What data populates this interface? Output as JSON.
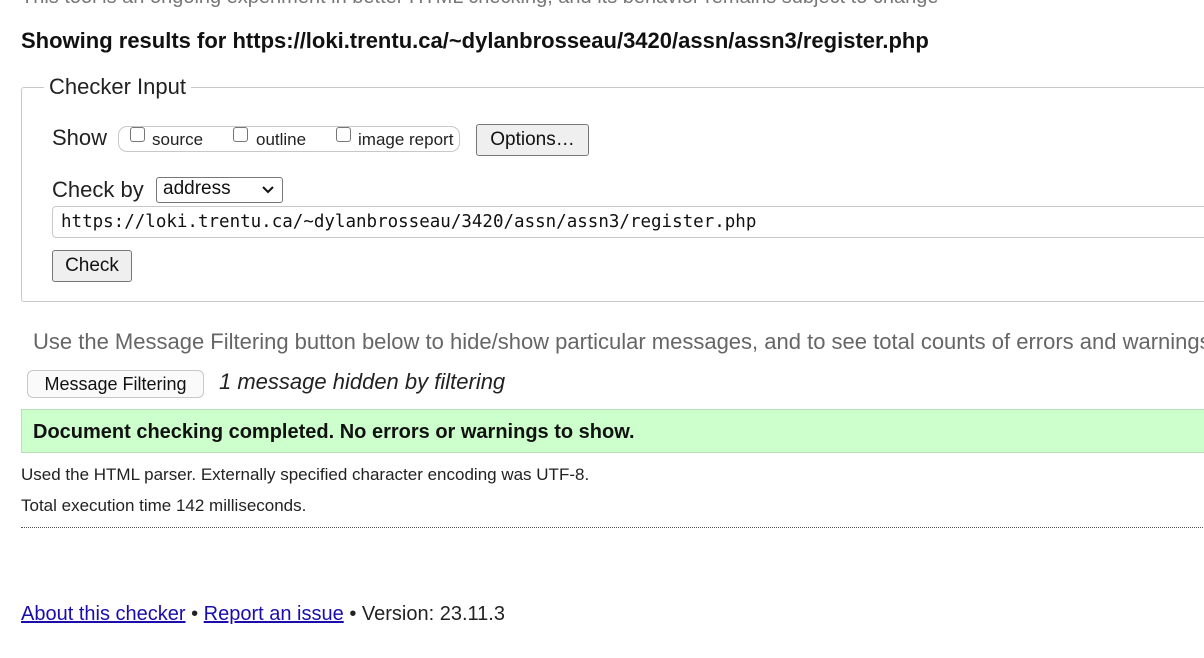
{
  "notice": "This tool is an ongoing experiment in better HTML checking, and its behavior remains subject to change",
  "results": {
    "heading_prefix": "Showing results for",
    "url": "https://loki.trentu.ca/~dylanbrosseau/3420/assn/assn3/register.php"
  },
  "checker": {
    "legend": "Checker Input",
    "show_label": "Show",
    "show_options": [
      {
        "label": "source",
        "checked": false
      },
      {
        "label": "outline",
        "checked": false
      },
      {
        "label": "image report",
        "checked": false
      }
    ],
    "options_button": "Options…",
    "check_by_label": "Check by",
    "check_by_value": "address",
    "url_value": "https://loki.trentu.ca/~dylanbrosseau/3420/assn/assn3/register.php",
    "check_button": "Check"
  },
  "filtering": {
    "note": "Use the Message Filtering button below to hide/show particular messages, and to see total counts of errors and warnings.",
    "button": "Message Filtering",
    "hidden_count": "1 message hidden by filtering"
  },
  "status": {
    "success": "Document checking completed. No errors or warnings to show.",
    "parser_note": "Used the HTML parser. Externally specified character encoding was UTF-8.",
    "timing_note": "Total execution time 142 milliseconds."
  },
  "footer": {
    "about_link": "About this checker",
    "separator": "•",
    "report_link": "Report an issue",
    "version": "Version: 23.11.3"
  },
  "colors": {
    "success_background": "#ccffcc",
    "link": "#1a0dab"
  }
}
